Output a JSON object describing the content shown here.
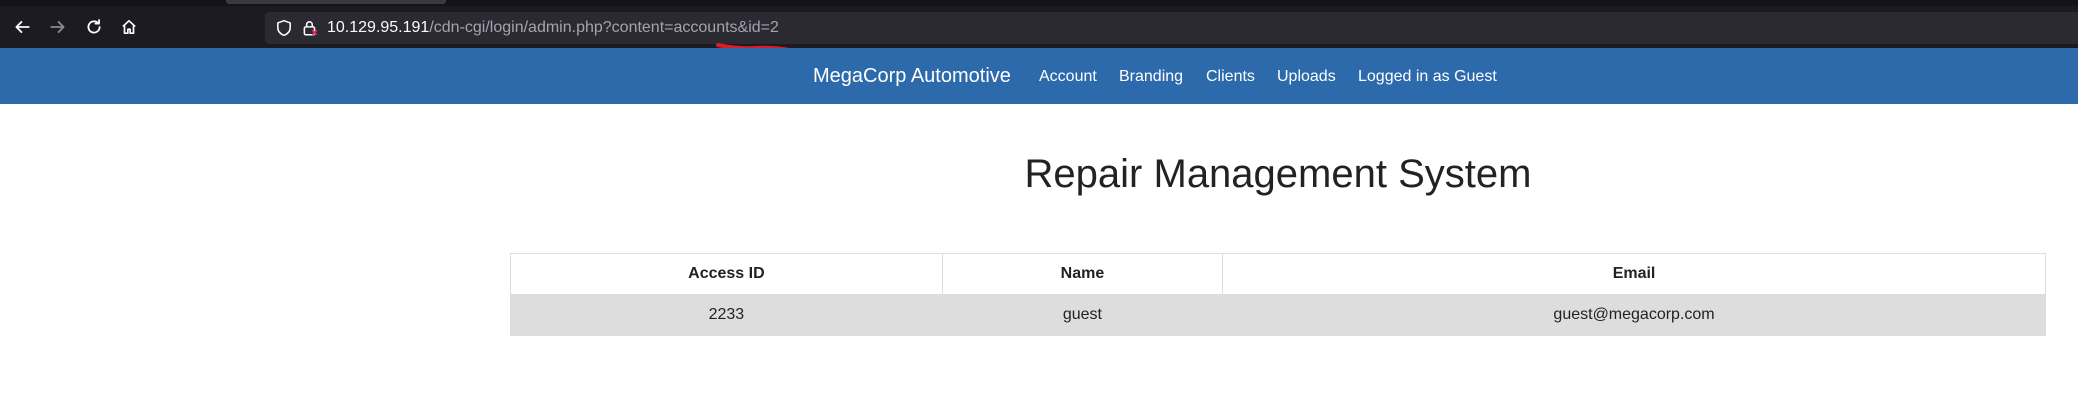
{
  "browser": {
    "url_host": "10.129.95.191",
    "url_path": "/cdn-cgi/login/admin.php?content=accounts&id=2",
    "icons": [
      "back-icon",
      "forward-icon",
      "reload-icon",
      "home-icon",
      "shield-icon",
      "lock-icon"
    ],
    "annotation_color": "#e01b24"
  },
  "navbar": {
    "brand": "MegaCorp Automotive",
    "links": [
      "Account",
      "Branding",
      "Clients",
      "Uploads",
      "Logged in as Guest"
    ],
    "background": "#2c6aab"
  },
  "main": {
    "title": "Repair Management System",
    "table": {
      "headers": [
        "Access ID",
        "Name",
        "Email"
      ],
      "rows": [
        [
          "2233",
          "guest",
          "guest@megacorp.com"
        ]
      ]
    }
  }
}
